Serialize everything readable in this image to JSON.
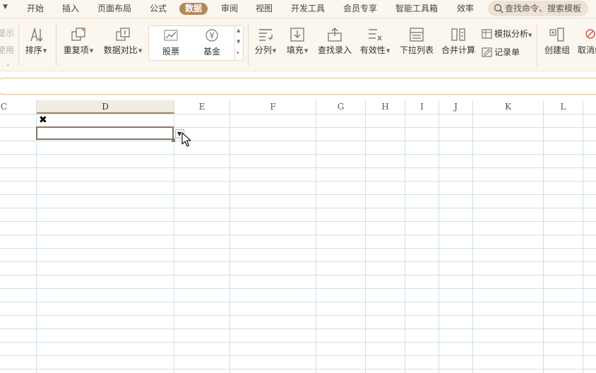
{
  "tabs": [
    {
      "label": "开始",
      "active": false
    },
    {
      "label": "插入",
      "active": false
    },
    {
      "label": "页面布局",
      "active": false
    },
    {
      "label": "公式",
      "active": false
    },
    {
      "label": "数据",
      "active": true
    },
    {
      "label": "审阅",
      "active": false
    },
    {
      "label": "视图",
      "active": false
    },
    {
      "label": "开发工具",
      "active": false
    },
    {
      "label": "会员专享",
      "active": false
    },
    {
      "label": "智能工具箱",
      "active": false
    },
    {
      "label": "效率",
      "active": false
    }
  ],
  "search": {
    "placeholder": "查找命令、搜索模板",
    "icon": "search-icon"
  },
  "ribbon": {
    "partial_left_top": "提示",
    "partial_left_bottom": "使用",
    "sort": "排序",
    "duplicates": "重复项",
    "compare": "数据对比",
    "stocks": "股票",
    "funds": "基金",
    "split": "分列",
    "fill": "填充",
    "lookup": "查找录入",
    "validity": "有效性",
    "dropdown_list": "下拉列表",
    "consolidate": "合并计算",
    "what_if": "模拟分析",
    "record_form": "记录单",
    "create_group": "创建组",
    "ungroup": "取消组"
  },
  "formula_bar": {
    "value": ""
  },
  "columns": [
    "C",
    "D",
    "E",
    "F",
    "G",
    "H",
    "I",
    "J",
    "K",
    "L"
  ],
  "selected_column": "D",
  "cell_mark": "✖",
  "dropdown_arrow": "▼",
  "colors": {
    "active_tab": "#b0885b",
    "ribbon_bg": "#fbf6ee",
    "grid_line": "#cfdfe8",
    "selection_border": "#8b7865",
    "formula_border": "#e2c08b"
  }
}
